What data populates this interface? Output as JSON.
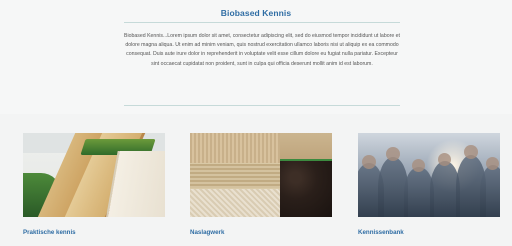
{
  "header": {
    "title": "Biobased Kennis"
  },
  "intro": {
    "text": "Biobased Kennis...Lorem ipsum dolor sit amet, consectetur adipiscing elit, sed do eiusmod tempor incididunt ut labore et dolore magna aliqua. Ut enim ad minim veniam, quis nostrud exercitation ullamco laboris nisi ut aliquip ex ea commodo consequat. Duis aute irure dolor in reprehenderit in voluptate velit esse cillum dolore eu fugiat nulla pariatur. Excepteur sint occaecat cupidatat non proident, sunt in culpa qui officia deserunt mollit anim id est laborum."
  },
  "cards": [
    {
      "label": "Praktische kennis"
    },
    {
      "label": "Naslagwerk"
    },
    {
      "label": "Kennissenbank"
    }
  ],
  "colors": {
    "accent": "#2f6da4",
    "rule": "#c6dad9",
    "background": "#f3f4f4"
  }
}
